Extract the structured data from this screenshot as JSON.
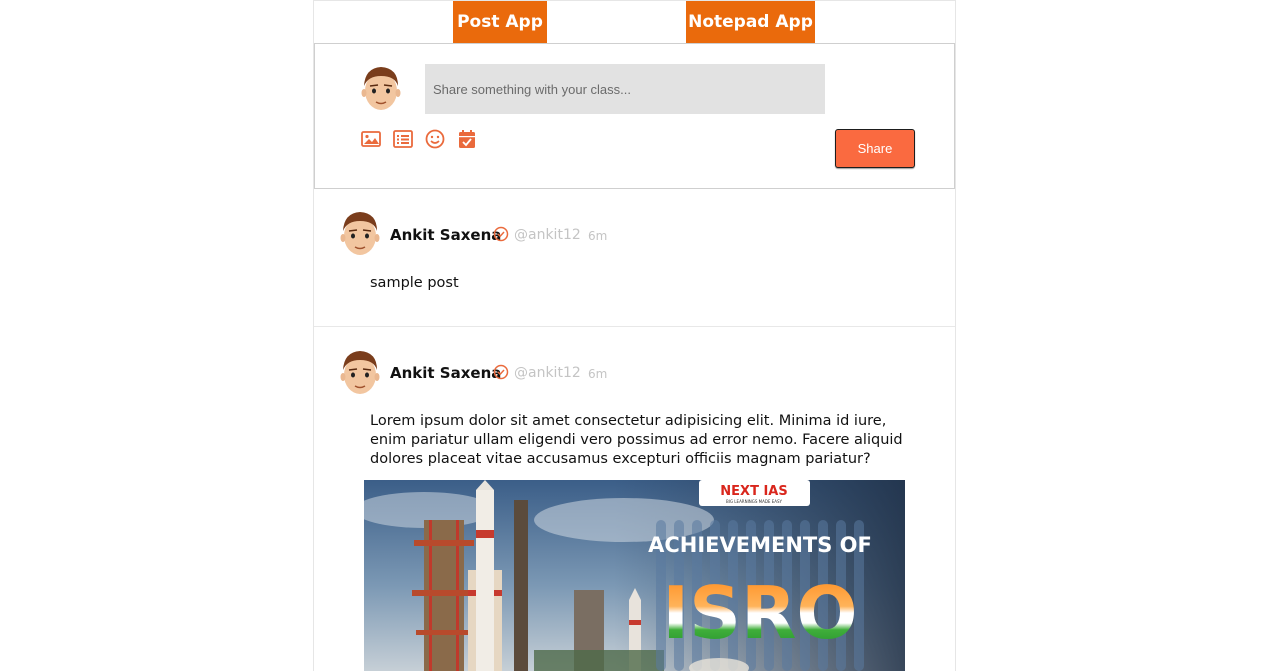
{
  "nav": {
    "post_app": "Post App",
    "notepad_app": "Notepad App"
  },
  "composer": {
    "placeholder": "Share something with your class...",
    "share_label": "Share",
    "tools": [
      "image-icon",
      "list-icon",
      "emoji-icon",
      "calendar-check-icon"
    ]
  },
  "posts": [
    {
      "author": "Ankit Saxena",
      "handle": "@ankit12",
      "time": "6m",
      "text": "sample post"
    },
    {
      "author": "Ankit Saxena",
      "handle": "@ankit12",
      "time": "6m",
      "text": "Lorem ipsum dolor sit amet consectetur adipisicing elit. Minima id iure, enim pariatur ullam eligendi vero possimus ad error nemo. Facere aliquid dolores placeat vitae accusamus excepturi officiis magnam pariatur?",
      "image": {
        "brand": "NEXT IAS",
        "tagline": "BIG LEARNINGS MADE EASY",
        "title_top": "ACHIEVEMENTS OF",
        "title_main": "ISRO"
      }
    }
  ],
  "colors": {
    "accent": "#ea6a0c",
    "share_button": "#fa6a40",
    "muted": "#c4c4c4"
  }
}
